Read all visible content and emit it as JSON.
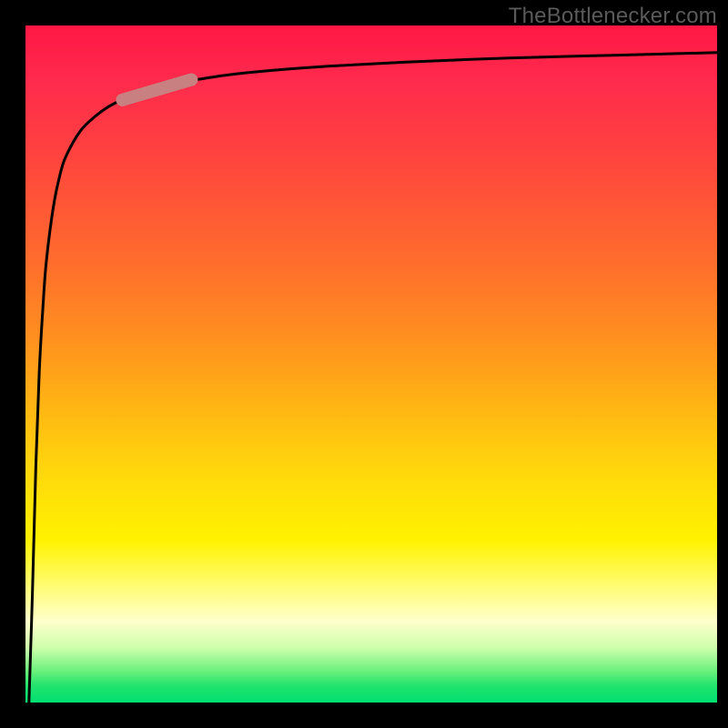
{
  "watermark": "TheBottlenecker.com",
  "colors": {
    "frame": "#000000",
    "watermark_text": "#5a5a5a",
    "curve_stroke": "#000000",
    "highlight_stroke": "#c98080",
    "gradient_stops": [
      "#ff1744",
      "#ff6a2d",
      "#ffd80c",
      "#fff200",
      "#ffffcc",
      "#00e070"
    ]
  },
  "chart_data": {
    "type": "line",
    "title": "",
    "xlabel": "",
    "ylabel": "",
    "xlim": [
      0,
      100
    ],
    "ylim": [
      0,
      100
    ],
    "grid": false,
    "legend": false,
    "x": [
      0.5,
      1.0,
      1.5,
      2,
      2.5,
      3,
      4,
      5,
      6,
      8,
      10,
      12,
      15,
      18,
      22,
      26,
      30,
      36,
      44,
      55,
      70,
      85,
      100
    ],
    "values": [
      0,
      16,
      35,
      49,
      58,
      65,
      73,
      78,
      81,
      84.5,
      86.5,
      88,
      89.5,
      90.5,
      91.5,
      92.2,
      92.8,
      93.4,
      94.0,
      94.6,
      95.2,
      95.6,
      96.0
    ],
    "highlight_segment": {
      "x_start": 14,
      "x_end": 24,
      "y_start": 89,
      "y_end": 92
    },
    "notes": "Axes are unlabeled in the source image. x and y normalized 0–100. Curve rises steeply from origin then asymptotes near y≈96. A short thick rosy segment highlights the curve around x≈14–24."
  }
}
